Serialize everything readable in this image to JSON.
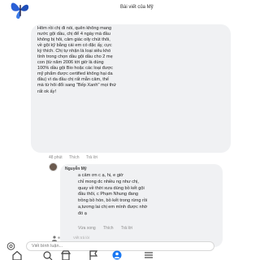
{
  "header": {
    "title": "Bài viết của Mỹ"
  },
  "post": {
    "text": "Hôm rồi chị đi nói, quên không mang\nnước gội dầu, chị để 4 ngày mà đầu\nkhông bị hôi, cảm giác oily chút thôi,\nvề gội kỹ bằng cái em có đặc ấy, cực\nkỳ thích. Chị tự nhận là loại siêu khó\ntính trong chọn dầu gội dầu cho 2 mẹ\ncon (từ năm 2006 tới giờ là dùng\n100% dầu gội Bio hoặc các loại được\nmỹ phẩm được certified không hại da\nđầu) vì da đầu chị rất mẫn cảm, thế\nmà từ hôi đổi sang \"Bếp Xanh\" mọi thứ\nrất ok ấy!",
    "time": "48 phút",
    "like": "Thích",
    "reply": "Trả lời"
  },
  "reply": {
    "name": "Nguyễn Mỹ",
    "text": "a cảm ơn c ạ, hi, e giờ\nchỉ mong dc nhiều ng như chị,\nquay về thời xưa dùng bồ kết gội\nđầu thôi, c Phạm Nhung đang\ntrồng bồ hòn, bồ kết trong rừng rồi\na,tương lai chị em mình được nhờ\nđó ạ",
    "time": "Vừa xong",
    "like": "Thích",
    "reply_label": "Trả lời"
  },
  "typing": {
    "text": "Viết trả lời"
  },
  "composer": {
    "placeholder": "Viết bình luận..."
  },
  "colors": {
    "bubble": "#f0f1f3",
    "accent": "#1877f2",
    "butterfly": "#2a5fd6"
  },
  "icons": [
    "butterfly-icon",
    "camera-icon",
    "home-icon",
    "search-icon",
    "store-icon",
    "flag-icon",
    "profile-icon",
    "menu-icon"
  ]
}
